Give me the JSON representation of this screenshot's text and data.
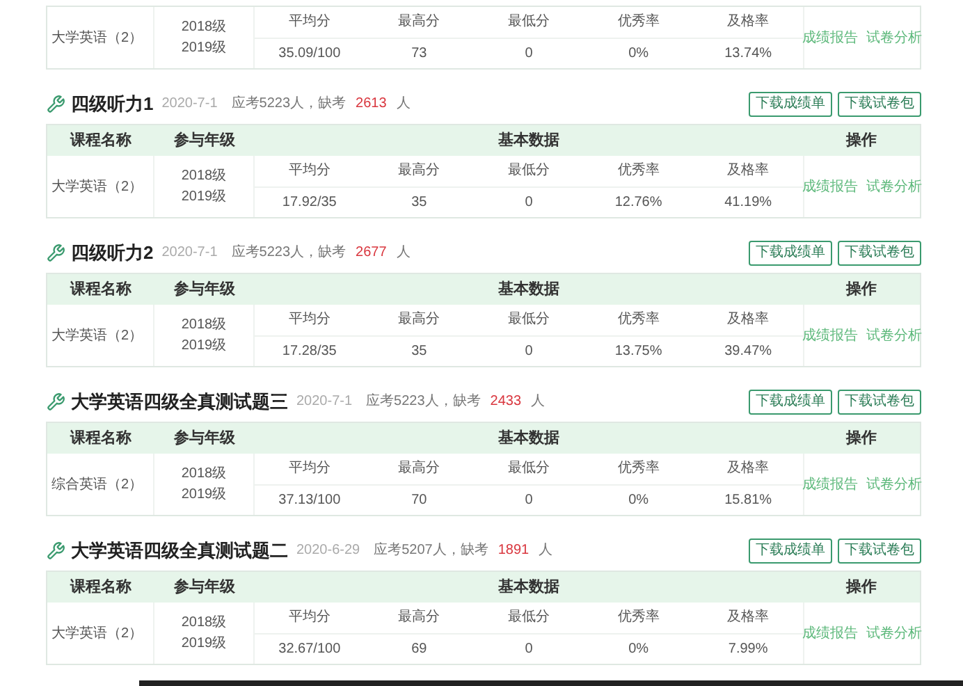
{
  "sections": [
    {
      "row": {
        "course": "大学英语（2）",
        "grades": [
          "2018级",
          "2019级"
        ],
        "metrics": [
          {
            "label": "平均分",
            "value": "35.09/100"
          },
          {
            "label": "最高分",
            "value": "73"
          },
          {
            "label": "最低分",
            "value": "0"
          },
          {
            "label": "优秀率",
            "value": "0%"
          },
          {
            "label": "及格率",
            "value": "13.74%"
          }
        ],
        "actions": [
          "成绩报告",
          "试卷分析"
        ]
      }
    },
    {
      "title": "四级听力1",
      "date": "2020-7-1",
      "expected": "应考5223人，缺考",
      "absent": "2613",
      "absent_unit": "人",
      "buttons": [
        "下载成绩单",
        "下载试卷包"
      ],
      "columns": [
        "课程名称",
        "参与年级",
        "基本数据",
        "操作"
      ],
      "row": {
        "course": "大学英语（2）",
        "grades": [
          "2018级",
          "2019级"
        ],
        "metrics": [
          {
            "label": "平均分",
            "value": "17.92/35"
          },
          {
            "label": "最高分",
            "value": "35"
          },
          {
            "label": "最低分",
            "value": "0"
          },
          {
            "label": "优秀率",
            "value": "12.76%"
          },
          {
            "label": "及格率",
            "value": "41.19%"
          }
        ],
        "actions": [
          "成绩报告",
          "试卷分析"
        ]
      }
    },
    {
      "title": "四级听力2",
      "date": "2020-7-1",
      "expected": "应考5223人，缺考",
      "absent": "2677",
      "absent_unit": "人",
      "buttons": [
        "下载成绩单",
        "下载试卷包"
      ],
      "columns": [
        "课程名称",
        "参与年级",
        "基本数据",
        "操作"
      ],
      "row": {
        "course": "大学英语（2）",
        "grades": [
          "2018级",
          "2019级"
        ],
        "metrics": [
          {
            "label": "平均分",
            "value": "17.28/35"
          },
          {
            "label": "最高分",
            "value": "35"
          },
          {
            "label": "最低分",
            "value": "0"
          },
          {
            "label": "优秀率",
            "value": "13.75%"
          },
          {
            "label": "及格率",
            "value": "39.47%"
          }
        ],
        "actions": [
          "成绩报告",
          "试卷分析"
        ]
      }
    },
    {
      "title": "大学英语四级全真测试题三",
      "date": "2020-7-1",
      "expected": "应考5223人，缺考",
      "absent": "2433",
      "absent_unit": "人",
      "buttons": [
        "下载成绩单",
        "下载试卷包"
      ],
      "columns": [
        "课程名称",
        "参与年级",
        "基本数据",
        "操作"
      ],
      "row": {
        "course": "综合英语（2）",
        "grades": [
          "2018级",
          "2019级"
        ],
        "metrics": [
          {
            "label": "平均分",
            "value": "37.13/100"
          },
          {
            "label": "最高分",
            "value": "70"
          },
          {
            "label": "最低分",
            "value": "0"
          },
          {
            "label": "优秀率",
            "value": "0%"
          },
          {
            "label": "及格率",
            "value": "15.81%"
          }
        ],
        "actions": [
          "成绩报告",
          "试卷分析"
        ]
      }
    },
    {
      "title": "大学英语四级全真测试题二",
      "date": "2020-6-29",
      "expected": "应考5207人，缺考",
      "absent": "1891",
      "absent_unit": "人",
      "buttons": [
        "下载成绩单",
        "下载试卷包"
      ],
      "columns": [
        "课程名称",
        "参与年级",
        "基本数据",
        "操作"
      ],
      "row": {
        "course": "大学英语（2）",
        "grades": [
          "2018级",
          "2019级"
        ],
        "metrics": [
          {
            "label": "平均分",
            "value": "32.67/100"
          },
          {
            "label": "最高分",
            "value": "69"
          },
          {
            "label": "最低分",
            "value": "0"
          },
          {
            "label": "优秀率",
            "value": "0%"
          },
          {
            "label": "及格率",
            "value": "7.99%"
          }
        ],
        "actions": [
          "成绩报告",
          "试卷分析"
        ]
      }
    }
  ]
}
